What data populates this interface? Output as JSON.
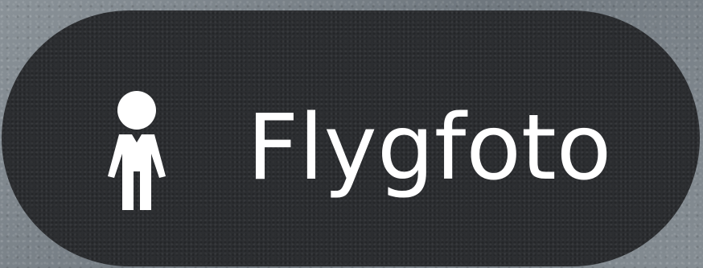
{
  "button": {
    "label": "Flygfoto",
    "icon": "person-icon"
  },
  "colors": {
    "pill_background": "#2c2e31",
    "text": "#ffffff",
    "map_background": "#7b838a"
  }
}
